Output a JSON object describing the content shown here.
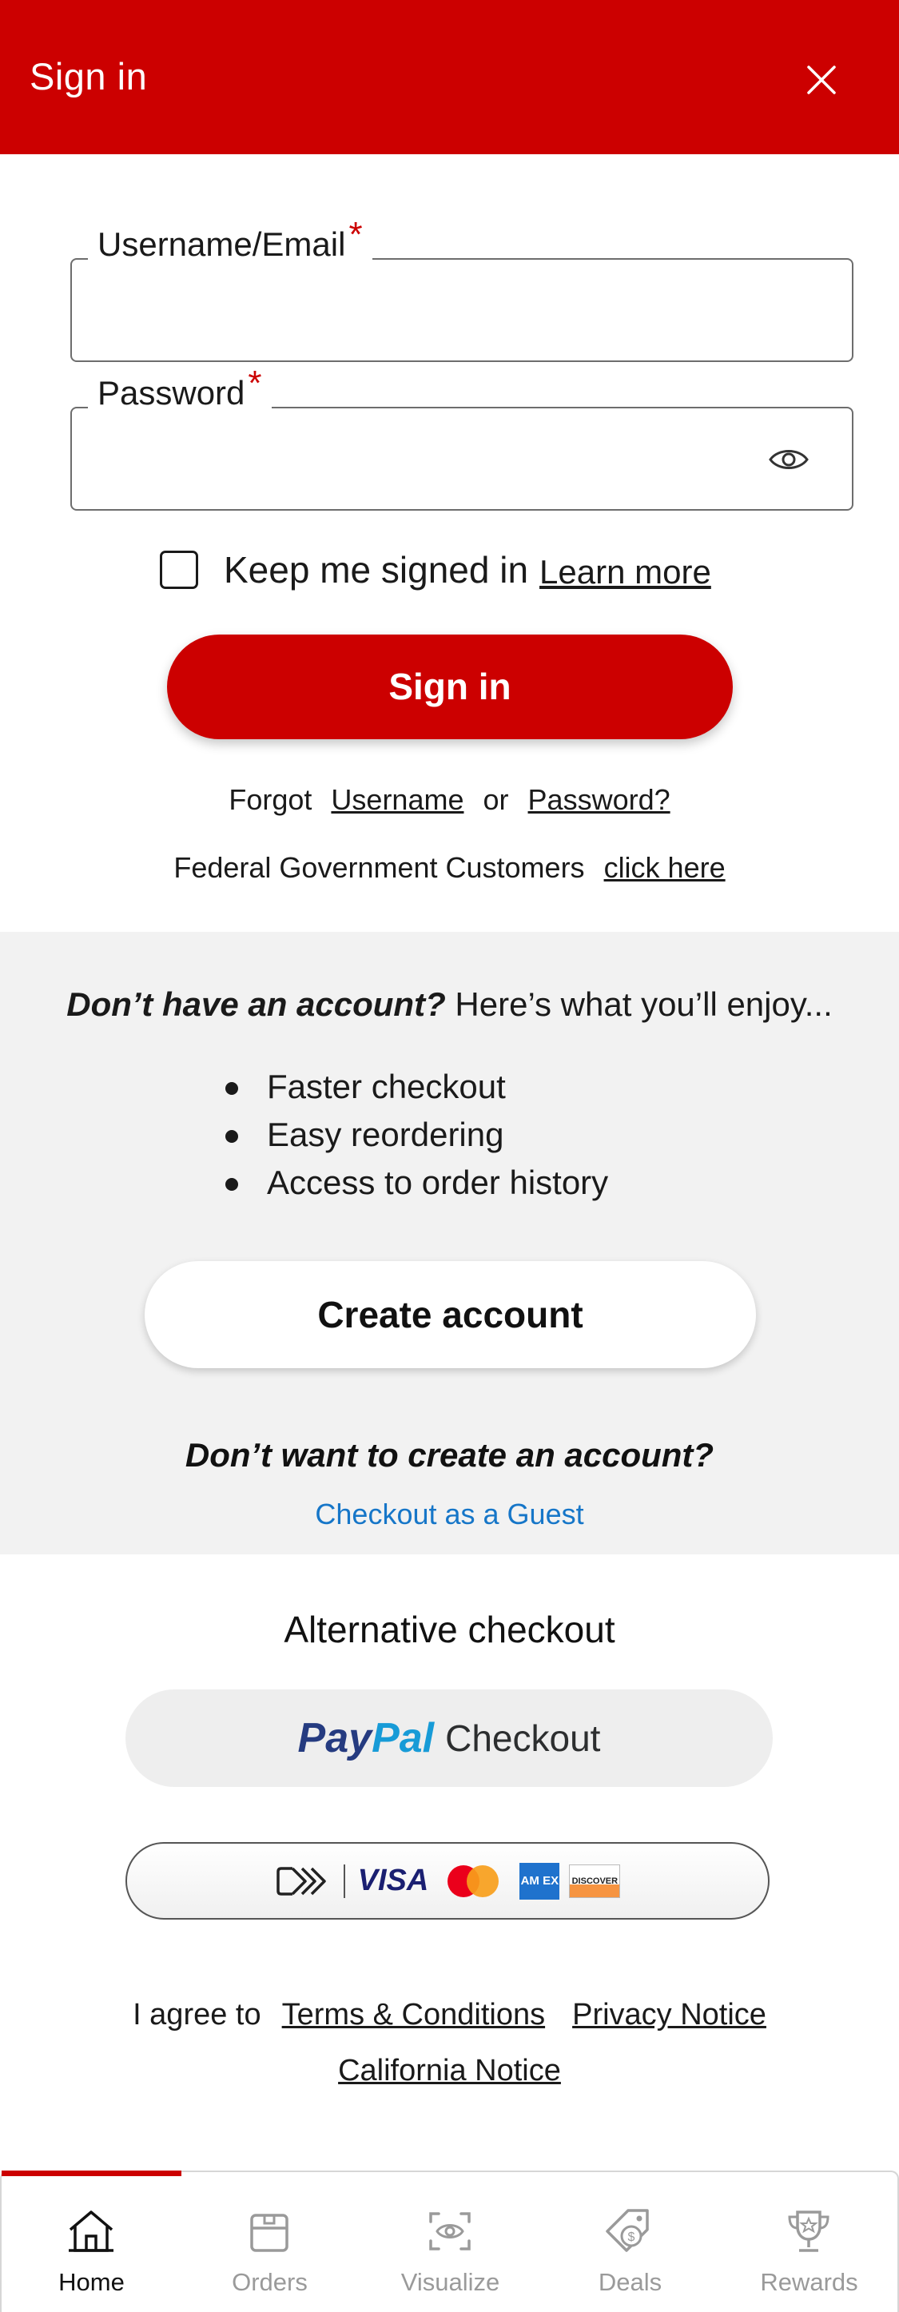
{
  "header": {
    "title": "Sign in"
  },
  "form": {
    "username_label": "Username/Email",
    "username_value": "",
    "password_label": "Password",
    "password_value": "",
    "required_marker": "*",
    "keep_signed_in_label": "Keep me signed in",
    "keep_signed_in_checked": false,
    "learn_more": "Learn more",
    "signin_button": "Sign in",
    "forgot_prefix": "Forgot",
    "forgot_username": "Username",
    "forgot_or": "or",
    "forgot_password": "Password?",
    "federal_text": "Federal Government Customers",
    "federal_link": "click here"
  },
  "promo": {
    "question": "Don’t have an account?",
    "enjoy": "Here’s what you’ll enjoy...",
    "benefits": [
      "Faster checkout",
      "Easy reordering",
      "Access to order history"
    ],
    "create_button": "Create account",
    "dont_want": "Don’t want to create an account?",
    "guest_link": "Checkout as a Guest"
  },
  "alternative": {
    "title": "Alternative checkout",
    "paypal_pay": "Pay",
    "paypal_pal": "Pal",
    "paypal_checkout": "Checkout",
    "visa": "VISA",
    "amex": "AM EX",
    "discover": "DISCOVER"
  },
  "legal": {
    "agree_prefix": "I agree to",
    "terms": "Terms & Conditions",
    "privacy": "Privacy Notice",
    "california": "California Notice"
  },
  "tabs": [
    {
      "label": "Home",
      "icon": "home-icon",
      "active": true
    },
    {
      "label": "Orders",
      "icon": "box-icon",
      "active": false
    },
    {
      "label": "Visualize",
      "icon": "scan-eye-icon",
      "active": false
    },
    {
      "label": "Deals",
      "icon": "price-tag-icon",
      "active": false
    },
    {
      "label": "Rewards",
      "icon": "trophy-icon",
      "active": false
    }
  ],
  "colors": {
    "brand_red": "#cc0000",
    "link_blue": "#1676c8",
    "panel_grey": "#f2f2f2",
    "paypal_dark": "#253b80",
    "paypal_light": "#179bd7"
  }
}
